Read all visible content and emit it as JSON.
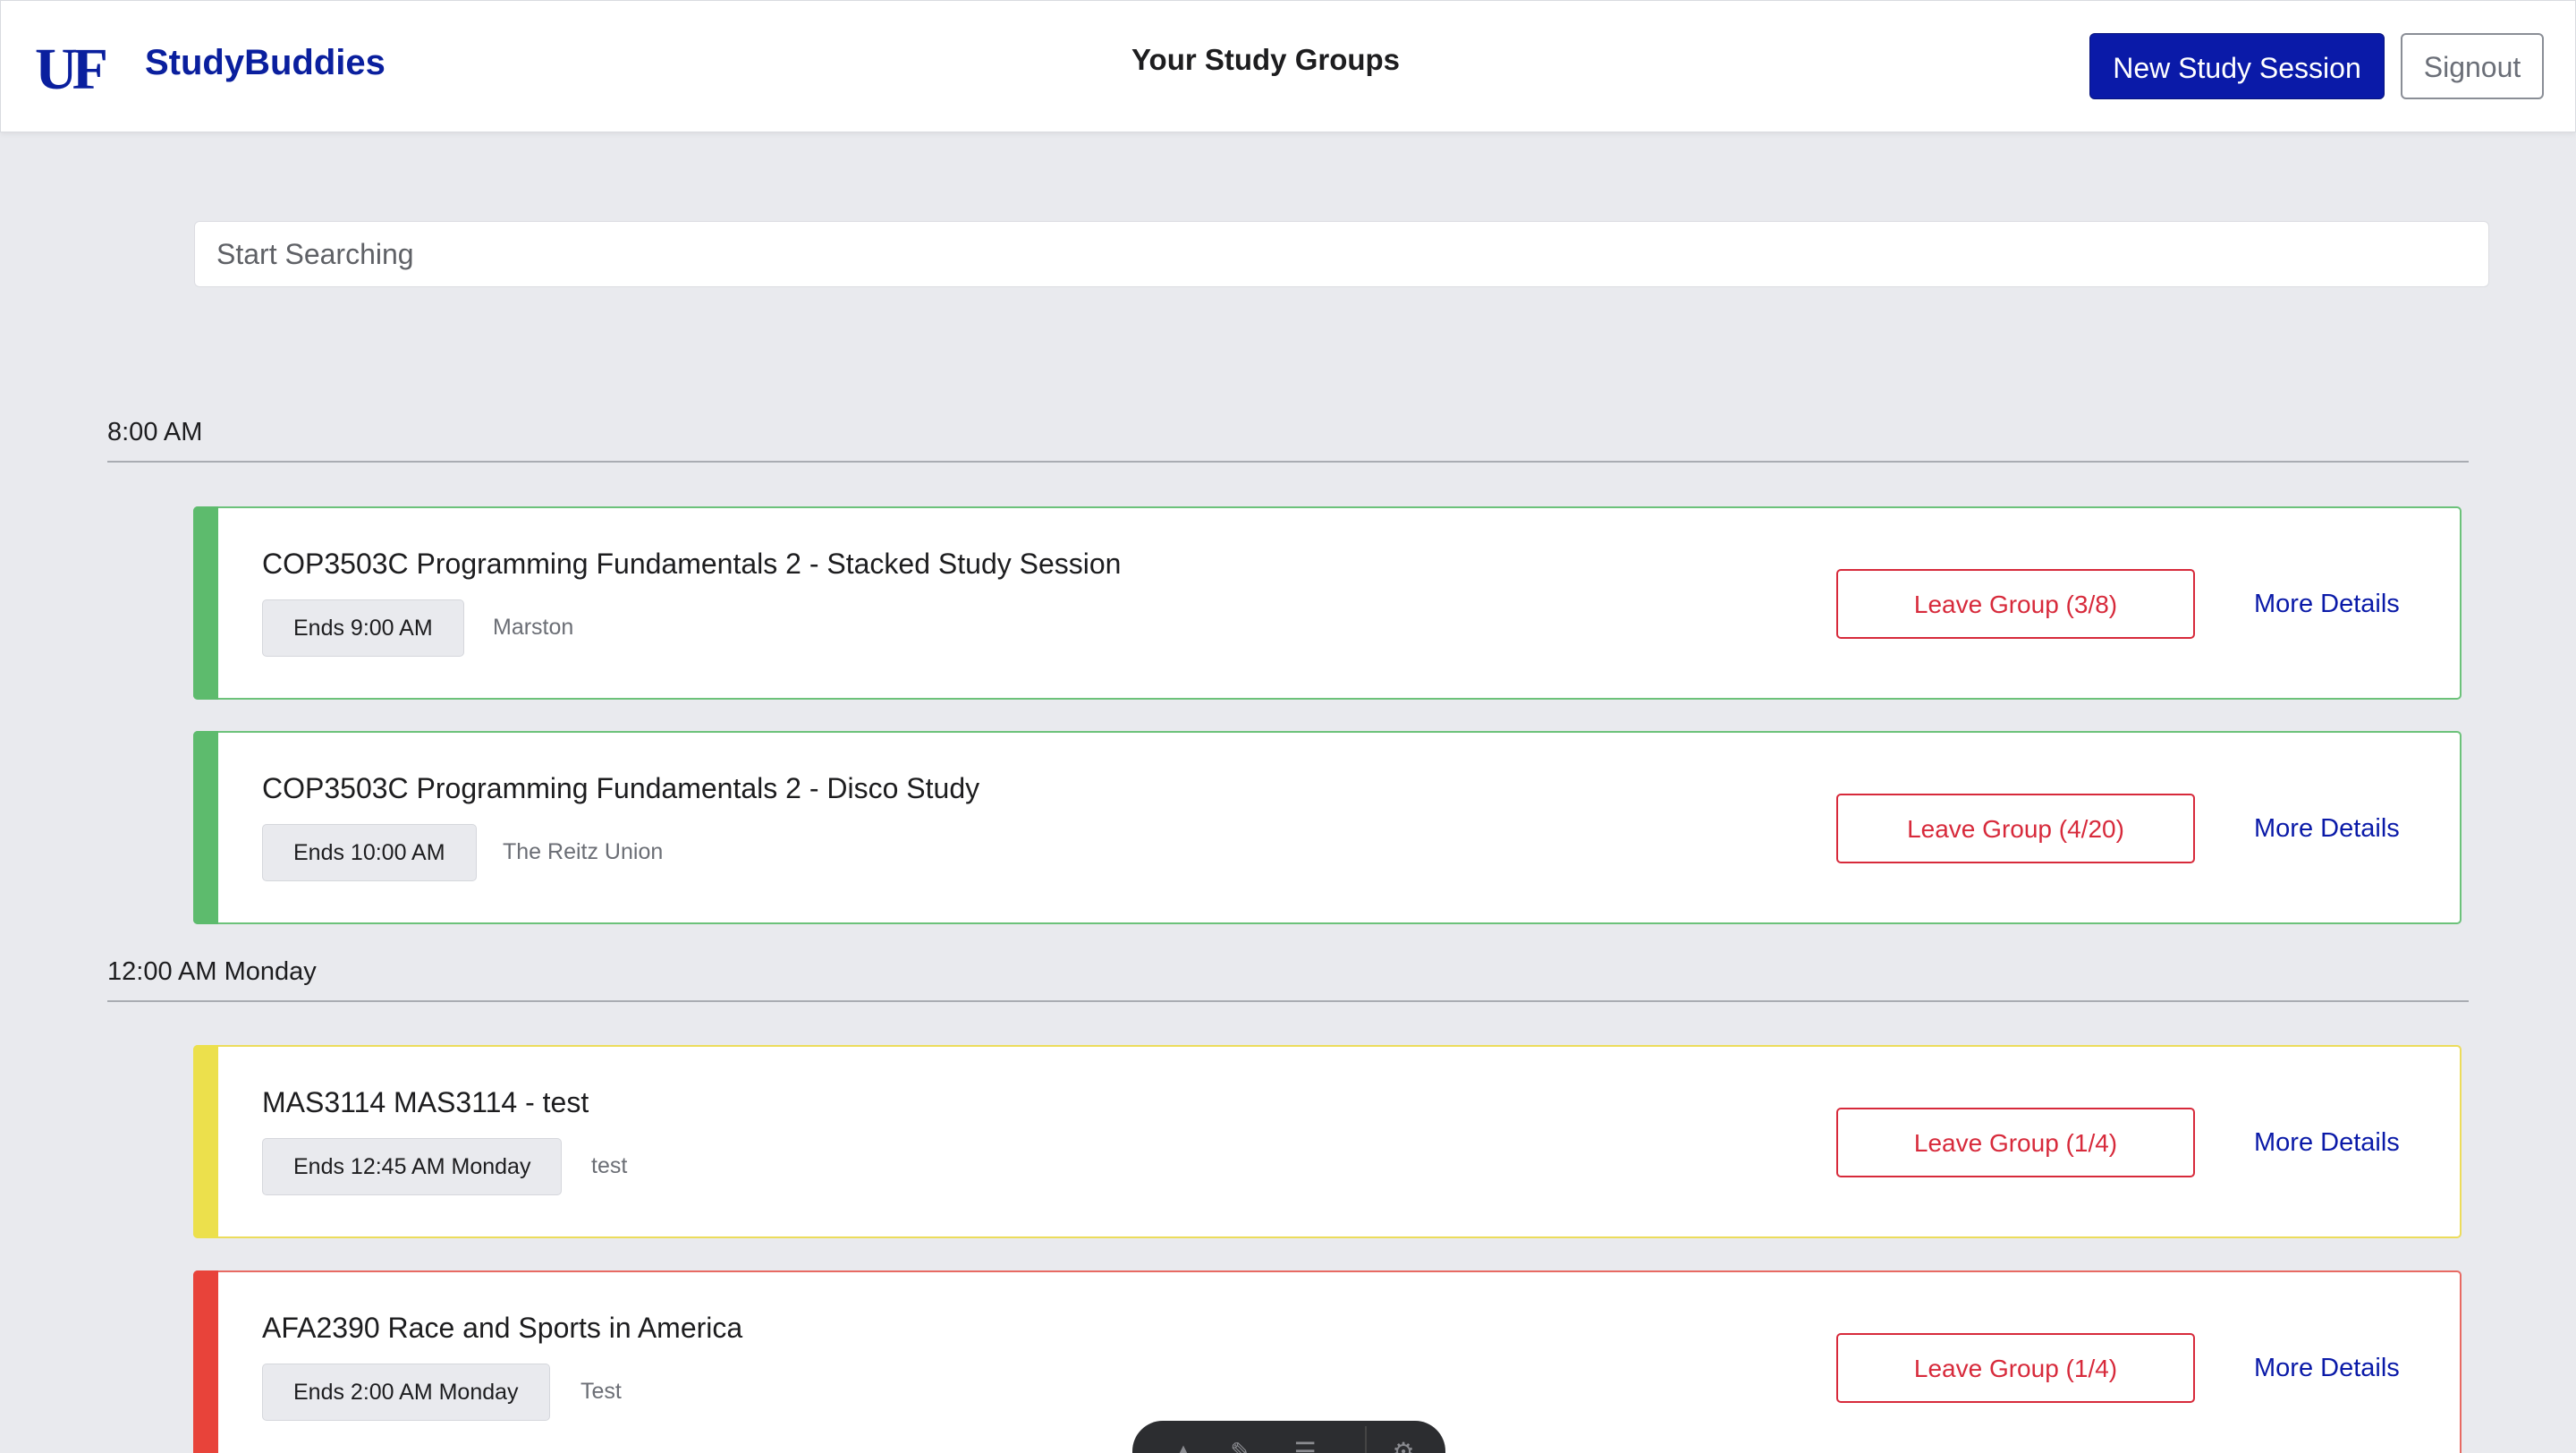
{
  "header": {
    "logo_text": "UF",
    "brand": "StudyBuddies",
    "title": "Your Study Groups",
    "new_session_label": "New Study Session",
    "signout_label": "Signout",
    "brand_color": "#0a1aa8"
  },
  "search": {
    "placeholder": "Start Searching"
  },
  "groups": [
    {
      "time_label": "8:00 AM",
      "sessions": [
        {
          "title": "COP3503C Programming Fundamentals 2 - Stacked Study Session",
          "ends": "Ends 9:00 AM",
          "location": "Marston",
          "leave_label": "Leave Group (3/8)",
          "details_label": "More Details",
          "color": "green"
        },
        {
          "title": "COP3503C Programming Fundamentals 2 - Disco Study",
          "ends": "Ends 10:00 AM",
          "location": "The Reitz Union",
          "leave_label": "Leave Group (4/20)",
          "details_label": "More Details",
          "color": "green"
        }
      ]
    },
    {
      "time_label": "12:00 AM Monday",
      "sessions": [
        {
          "title": "MAS3114 MAS3114 - test",
          "ends": "Ends 12:45 AM Monday",
          "location": "test",
          "leave_label": "Leave Group (1/4)",
          "details_label": "More Details",
          "color": "yellow"
        },
        {
          "title": "AFA2390 Race and Sports in America",
          "ends": "Ends 2:00 AM Monday",
          "location": "Test",
          "leave_label": "Leave Group (1/4)",
          "details_label": "More Details",
          "color": "red"
        }
      ]
    }
  ],
  "floating_toolbar": {
    "icons": [
      "pointer-icon",
      "pen-icon",
      "notes-icon",
      "settings-icon"
    ]
  }
}
